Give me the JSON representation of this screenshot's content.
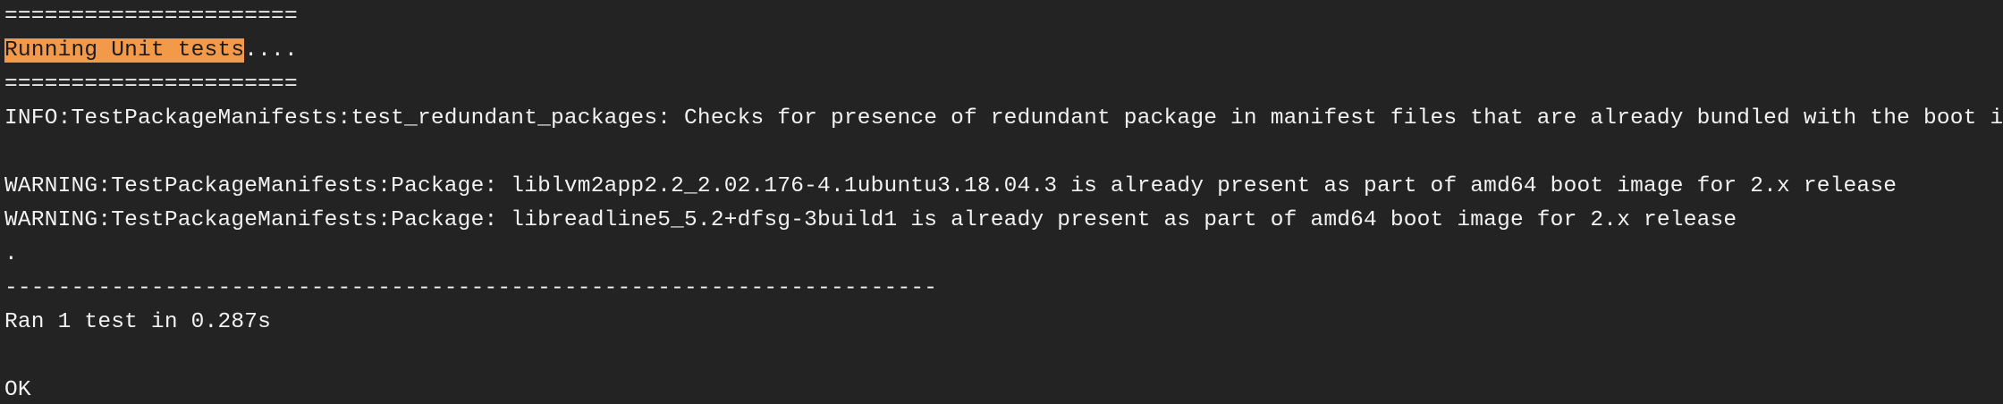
{
  "terminal": {
    "lines": [
      {
        "text": "======================"
      },
      {
        "highlight": "Running Unit tests",
        "rest": "...."
      },
      {
        "text": "======================"
      },
      {
        "text": "INFO:TestPackageManifests:test_redundant_packages: Checks for presence of redundant package in manifest files that are already bundled with the boot image"
      },
      {
        "text": ""
      },
      {
        "text": "WARNING:TestPackageManifests:Package: liblvm2app2.2_2.02.176-4.1ubuntu3.18.04.3 is already present as part of amd64 boot image for 2.x release"
      },
      {
        "text": "WARNING:TestPackageManifests:Package: libreadline5_5.2+dfsg-3build1 is already present as part of amd64 boot image for 2.x release"
      },
      {
        "text": "."
      },
      {
        "text": "----------------------------------------------------------------------"
      },
      {
        "text": "Ran 1 test in 0.287s"
      },
      {
        "text": ""
      },
      {
        "text": "OK"
      }
    ]
  },
  "colors": {
    "background": "#232323",
    "foreground": "#f2f2f2",
    "highlight": "#f2994a"
  }
}
